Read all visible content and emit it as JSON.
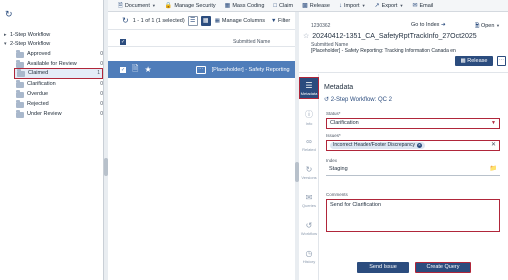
{
  "colors": {
    "accent": "#2b4c7e",
    "row_selected": "#4f7dba",
    "highlight_border": "#b0263a"
  },
  "tree": {
    "refresh_icon": "refresh-icon",
    "items": [
      {
        "label": "1-Step Workflow",
        "count": ""
      },
      {
        "label": "2-Step Workflow",
        "count": ""
      },
      {
        "label": "Approved",
        "count": "0"
      },
      {
        "label": "Available for Review",
        "count": "0"
      },
      {
        "label": "Claimed",
        "count": "1"
      },
      {
        "label": "Clarification",
        "count": "0"
      },
      {
        "label": "Overdue",
        "count": "0"
      },
      {
        "label": "Rejected",
        "count": "0"
      },
      {
        "label": "Under Review",
        "count": "0"
      }
    ]
  },
  "toolbar": {
    "items": [
      "Document",
      "Manage Security",
      "Mass Coding",
      "Claim",
      "Release",
      "Import",
      "Export",
      "Email"
    ]
  },
  "list": {
    "count_text": "1 - 1 of 1 (1 selected)",
    "manage_columns": "Manage Columns",
    "filter": "Filter",
    "column_header": "Submitted Name",
    "row_title": "[Placeholder] - Safety Reporting"
  },
  "detail": {
    "id": "1230362",
    "go_to_index": "Go to Index",
    "open": "Open",
    "title": "20240412-1351_CA_SafetyRptTrackInfo_27Oct2025",
    "submitted_name_label": "Submitted Name",
    "submitted_name_value": "[Placeholder] - Safety Reporting: Tracking Information Canada en",
    "release_button": "Release",
    "nav": [
      "Metadata",
      "Info",
      "Related",
      "Versions",
      "Queries",
      "Workflow",
      "History"
    ],
    "metadata_title": "Metadata",
    "workflow_label": "2-Step Workflow: QC 2",
    "status_label": "Status*",
    "status_value": "Clarification",
    "issues_label": "Issues*",
    "issues_value": "Incorrect Header/Footer Discrepancy",
    "index_label": "Index",
    "index_value": "Staging",
    "comments_label": "Comments",
    "comments_value": "Send for Clarification",
    "send_issue": "Send Issue",
    "create_query": "Create Query"
  }
}
